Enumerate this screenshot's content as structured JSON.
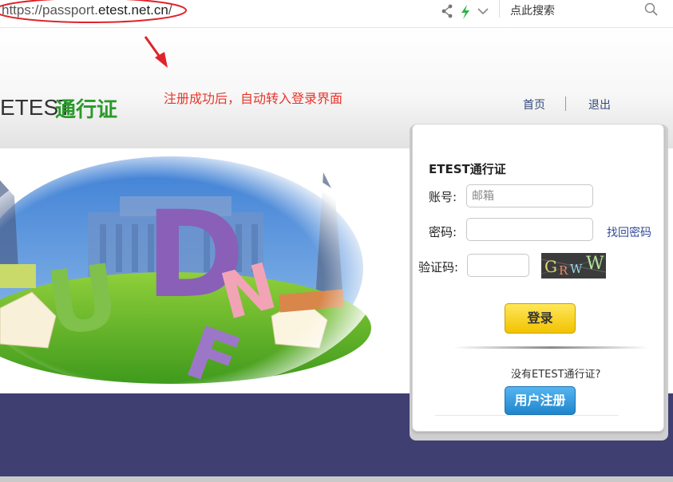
{
  "browser": {
    "url_prefix": "https://passport.",
    "url_domain": "etest.net.cn",
    "url_suffix": "/",
    "search_label": "点此搜索"
  },
  "header": {
    "logo_text": "ETEST",
    "logo_suffix": "通行证",
    "annotation": "注册成功后，自动转入登录界面",
    "nav": {
      "home": "首页",
      "logout": "退出"
    }
  },
  "banner": {
    "letters": [
      "D",
      "U",
      "N",
      "F"
    ]
  },
  "login": {
    "title": "ETEST通行证",
    "account_label": "账号:",
    "account_placeholder": "邮箱",
    "password_label": "密码:",
    "forgot_link": "找回密码",
    "captcha_label": "验证码:",
    "captcha_text": "GRWW",
    "login_button": "登录",
    "no_account_text": "没有ETEST通行证?",
    "register_button": "用户注册"
  },
  "colors": {
    "logo_green": "#2a9a2a",
    "annotation_red": "#e8352b",
    "footer_band": "#3f3f72",
    "login_yellow": "#f1c300",
    "register_blue": "#1f85cc"
  },
  "icons": [
    "share-icon",
    "lightning-icon",
    "chevron-down-icon",
    "search-icon",
    "red-arrow-icon"
  ]
}
